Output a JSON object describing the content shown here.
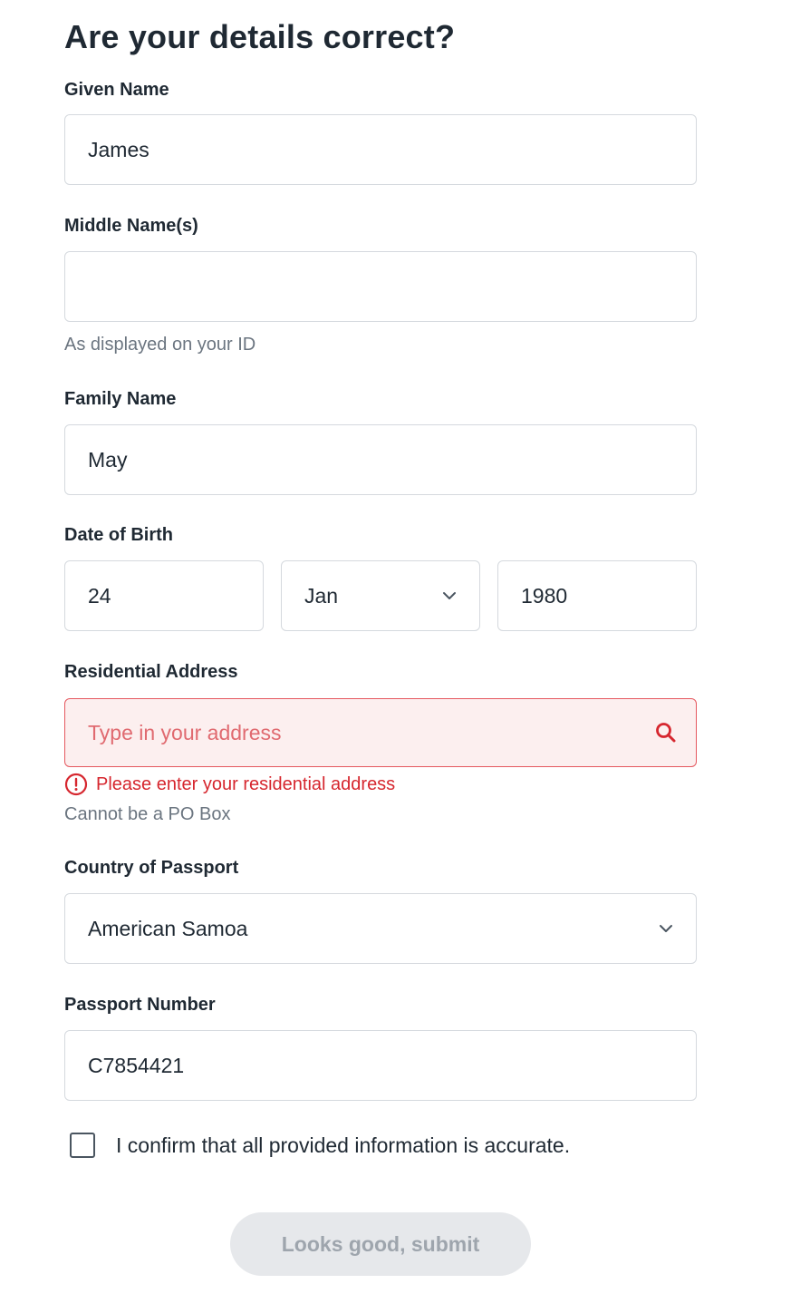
{
  "form": {
    "title": "Are your details correct?",
    "given_name": {
      "label": "Given Name",
      "value": "James"
    },
    "middle_name": {
      "label": "Middle Name(s)",
      "value": "",
      "hint": "As displayed on your ID"
    },
    "family_name": {
      "label": "Family Name",
      "value": "May"
    },
    "dob": {
      "label": "Date of Birth",
      "day": "24",
      "month": "Jan",
      "year": "1980"
    },
    "address": {
      "label": "Residential Address",
      "placeholder": "Type in your address",
      "value": "",
      "error": "Please enter your residential address",
      "hint": "Cannot be a PO Box"
    },
    "passport_country": {
      "label": "Country of Passport",
      "value": "American Samoa"
    },
    "passport_number": {
      "label": "Passport Number",
      "value": "C7854421"
    },
    "confirm": {
      "label": "I confirm that all provided information is accurate.",
      "checked": false
    },
    "submit_label": "Looks good, submit"
  },
  "colors": {
    "error": "#d6262e",
    "error_bg": "#fcefef",
    "border": "#d5d9de",
    "button_disabled_bg": "#e6e8eb",
    "button_disabled_text": "#9ea5ad"
  },
  "icons": {
    "month_dropdown": "chevron-down-icon",
    "country_dropdown": "chevron-down-icon",
    "address_search": "search-icon",
    "address_error": "error-circle-icon"
  }
}
